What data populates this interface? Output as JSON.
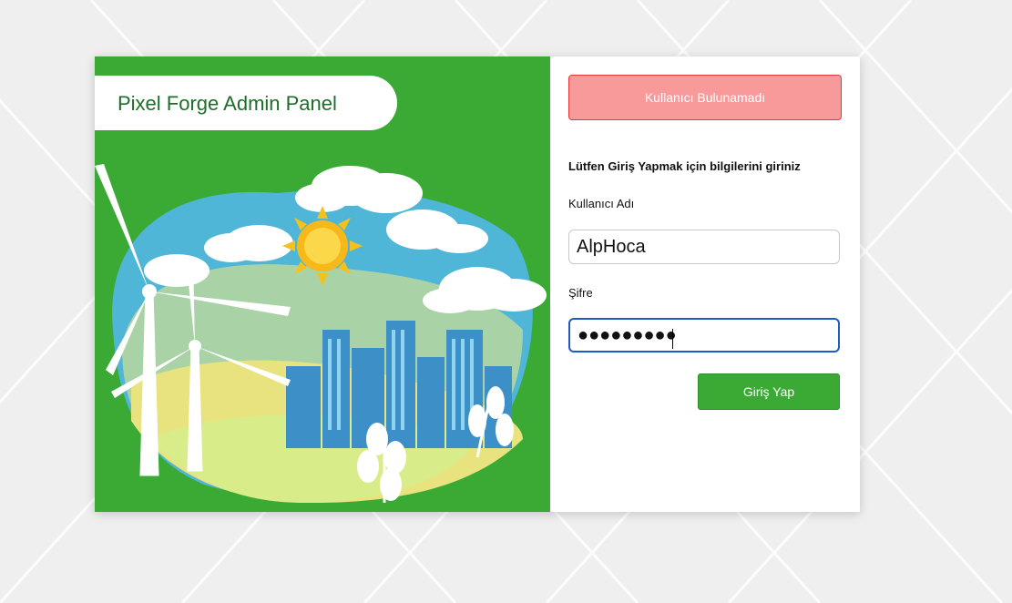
{
  "brand": {
    "title": "Pixel Forge Admin Panel"
  },
  "alert": {
    "message": "Kullanıcı Bulunamadı"
  },
  "form": {
    "prompt": "Lütfen Giriş Yapmak için bilgilerini giriniz",
    "username_label": "Kullanıcı Adı",
    "username_value": "AlpHoca",
    "password_label": "Şifre",
    "password_value": "●●●●●●●●●",
    "submit_label": "Giriş Yap"
  },
  "colors": {
    "brand_green": "#3aaa35",
    "alert_bg": "#f89a99",
    "focus_blue": "#1e5bc6"
  }
}
